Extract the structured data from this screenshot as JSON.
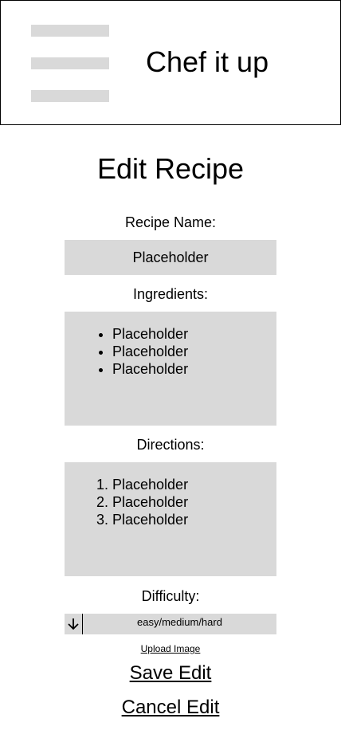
{
  "header": {
    "app_title": "Chef it up",
    "menu_icon": "hamburger-menu-icon"
  },
  "page": {
    "title": "Edit Recipe"
  },
  "recipe_name": {
    "label": "Recipe Name:",
    "value": "Placeholder"
  },
  "ingredients": {
    "label": "Ingredients:",
    "items": [
      "Placeholder",
      "Placeholder",
      "Placeholder"
    ]
  },
  "directions": {
    "label": "Directions:",
    "items": [
      "Placeholder",
      "Placeholder",
      "Placeholder"
    ]
  },
  "difficulty": {
    "label": "Difficulty:",
    "selected": "easy/medium/hard",
    "arrow_icon": "arrow-down-icon"
  },
  "actions": {
    "upload_image": "Upload Image",
    "save_edit": "Save Edit",
    "cancel_edit": "Cancel Edit"
  },
  "colors": {
    "field_background": "#d9d9d9",
    "text": "#000000",
    "background": "#ffffff"
  }
}
